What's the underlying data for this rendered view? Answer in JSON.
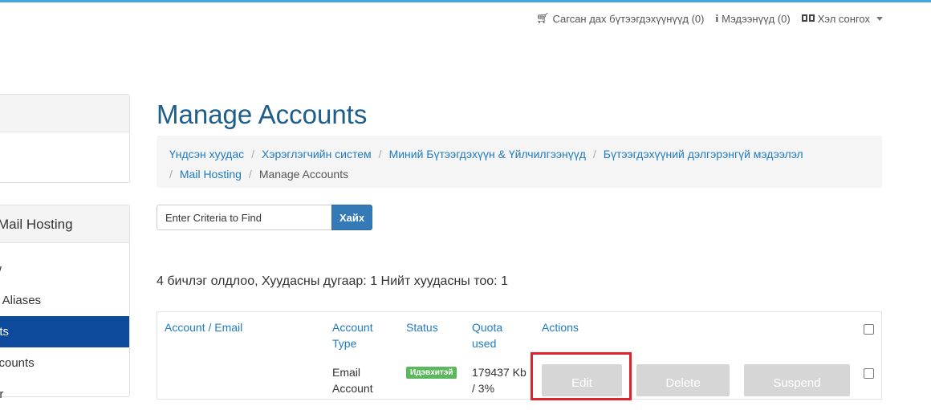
{
  "topbar": {
    "cart": "Сагсан дах бүтээгдэхүүнүүд (0)",
    "notifications": "Мэдээнүүд (0)",
    "language": "Хэл сонгох",
    "icons": [
      "cart-icon",
      "info-icon",
      "language-icon"
    ]
  },
  "sidebar": {
    "section_title": "Mail Hosting",
    "items": [
      {
        "label": "w"
      },
      {
        "label": "n Aliases"
      },
      {
        "label": "nts"
      },
      {
        "label": "ccounts"
      },
      {
        "label": "er"
      }
    ],
    "active_color": "#0d4a9b"
  },
  "page": {
    "title": "Manage Accounts"
  },
  "breadcrumb": [
    {
      "label": "Үндсэн хуудас"
    },
    {
      "label": "Хэрэглэгчийн систем"
    },
    {
      "label": "Миний Бүтээгдэхүүн & Үйлчилгээнүүд"
    },
    {
      "label": "Бүтээгдэхүүний дэлгэрэнгүй мэдээлэл"
    },
    {
      "label": "Mail Hosting"
    },
    {
      "label": "Manage Accounts"
    }
  ],
  "search": {
    "placeholder": "Enter Criteria to Find",
    "button": "Хайх"
  },
  "records_summary": "4 бичлэг олдлоо, Хуудасны дугаар: 1 Нийт хуудасны тоо: 1",
  "table": {
    "headers": {
      "account": "Account / Email",
      "type_line1": "Account",
      "type_line2": "Type",
      "status": "Status",
      "quota_line1": "Quota",
      "quota_line2": "used",
      "actions": "Actions"
    },
    "rows": [
      {
        "account": "",
        "type_line1": "Email",
        "type_line2": "Account",
        "status": "Идэвхитэй",
        "quota_line1": "179437 Kb",
        "quota_line2": "/ 3%",
        "actions": {
          "edit": "Edit",
          "delete": "Delete",
          "suspend": "Suspend"
        }
      }
    ]
  },
  "colors": {
    "accent": "#337ab7",
    "link": "#1f7bc0",
    "title": "#1d5e8a",
    "status_active": "#5cb85c",
    "highlight_box": "#e0232c"
  }
}
